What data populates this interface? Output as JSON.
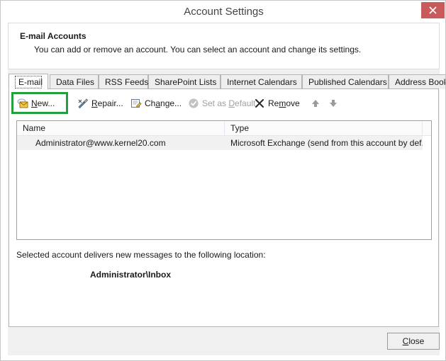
{
  "window": {
    "title": "Account Settings",
    "close_icon": "close-icon"
  },
  "header": {
    "title": "E-mail Accounts",
    "description": "You can add or remove an account. You can select an account and change its settings."
  },
  "tabs": [
    {
      "label": "E-mail",
      "active": true
    },
    {
      "label": "Data Files",
      "active": false
    },
    {
      "label": "RSS Feeds",
      "active": false
    },
    {
      "label": "SharePoint Lists",
      "active": false
    },
    {
      "label": "Internet Calendars",
      "active": false
    },
    {
      "label": "Published Calendars",
      "active": false
    },
    {
      "label": "Address Books",
      "active": false
    }
  ],
  "toolbar": {
    "new_label": "New...",
    "repair_label": "Repair...",
    "change_label": "Change...",
    "set_as_default_label": "Set as Default",
    "remove_label": "Remove",
    "move_up_icon": "arrow-up-icon",
    "move_down_icon": "arrow-down-icon",
    "highlight_color": "#23a03e",
    "highlighted_item": "New..."
  },
  "account_list": {
    "columns": [
      "Name",
      "Type",
      ""
    ],
    "rows": [
      {
        "name": "Administrator@www.kernel20.com",
        "type": "Microsoft Exchange (send from this account by def...",
        "extra": "",
        "selected": true,
        "icon": "exchange-account-icon"
      }
    ]
  },
  "delivery": {
    "label": "Selected account delivers new messages to the following location:",
    "value": "Administrator\\Inbox"
  },
  "footer": {
    "close_label": "Close"
  },
  "colors": {
    "accent_green": "#23a03e",
    "close_red": "#c75b5b",
    "selection_gray": "#f1f1f1"
  }
}
